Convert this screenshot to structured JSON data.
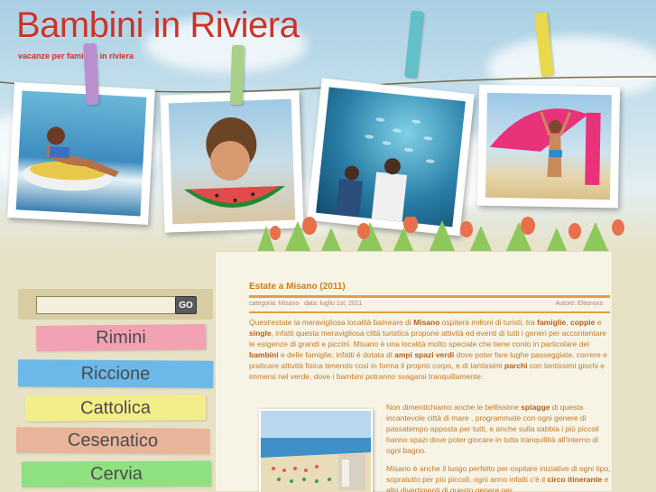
{
  "site": {
    "title": "Bambini in Riviera",
    "tagline": "vacanze per famiglie in riviera"
  },
  "search": {
    "placeholder": "",
    "button_label": "GO"
  },
  "nav": {
    "items": [
      {
        "label": "Rimini",
        "color": "#f2a2b2"
      },
      {
        "label": "Riccione",
        "color": "#6cb8e8"
      },
      {
        "label": "Cattolica",
        "color": "#f4ee8a"
      },
      {
        "label": "Cesenatico",
        "color": "#e8b49a"
      },
      {
        "label": "Cervia",
        "color": "#8fe080"
      }
    ]
  },
  "post": {
    "title": "Estate a Misano (2011)",
    "meta": "categoria: Misano   data: luglio 1st, 2011",
    "author": "Autore: Eleonora",
    "para1": [
      "Quest'estate la meravigliosa località balneare di ",
      "Misano",
      " ospiterà milioni di turisti, tra ",
      "famiglie",
      ", ",
      "coppie",
      " e ",
      "single",
      ", infatti questa meravigliosa  città turistica  propone attività ed eventi di tutti i generi per accontentare le esigenze di grandi e piccini. Misano è una località molto speciale che tiene conto in particolare dei ",
      "bambini",
      " e delle famiglie; infatti è dotata di ",
      "ampi spazi verdi",
      " dove poter fare lughe passeggiate, correre e praticare attività fisica tenendo così in forma il proprio corpo, e di tantissimi ",
      "parchi",
      " con tantissimi giochi e immersi nel verde, dove i bambini potranno svagarsi tranquillamente."
    ],
    "para2": [
      "Non dimentichiamo anche le bellissime ",
      "spiagge",
      " di questa incantevole città di mare , programmate con ogni genere di passatempo apposta per tutti, e  anche sulla sabbia i più piccoli hanno spazi dove poter giocare in tutta tranquillità all'interno di ogni bagno."
    ],
    "para3": [
      "Misano è anche il luogo perfetto per ospitare iniziative di ogni tipo, sopratutto per più piccoli, ogni anno infatti c'è il ",
      "circo itinerante",
      " e altri divertimenti di questo genere per"
    ]
  },
  "colors": {
    "title_red": "#c9352a",
    "text_orange": "#c27a28",
    "rule_orange": "#e0a040"
  },
  "icons": {
    "pegs": [
      "peg-purple",
      "peg-green",
      "peg-blue",
      "peg-yellow"
    ]
  }
}
